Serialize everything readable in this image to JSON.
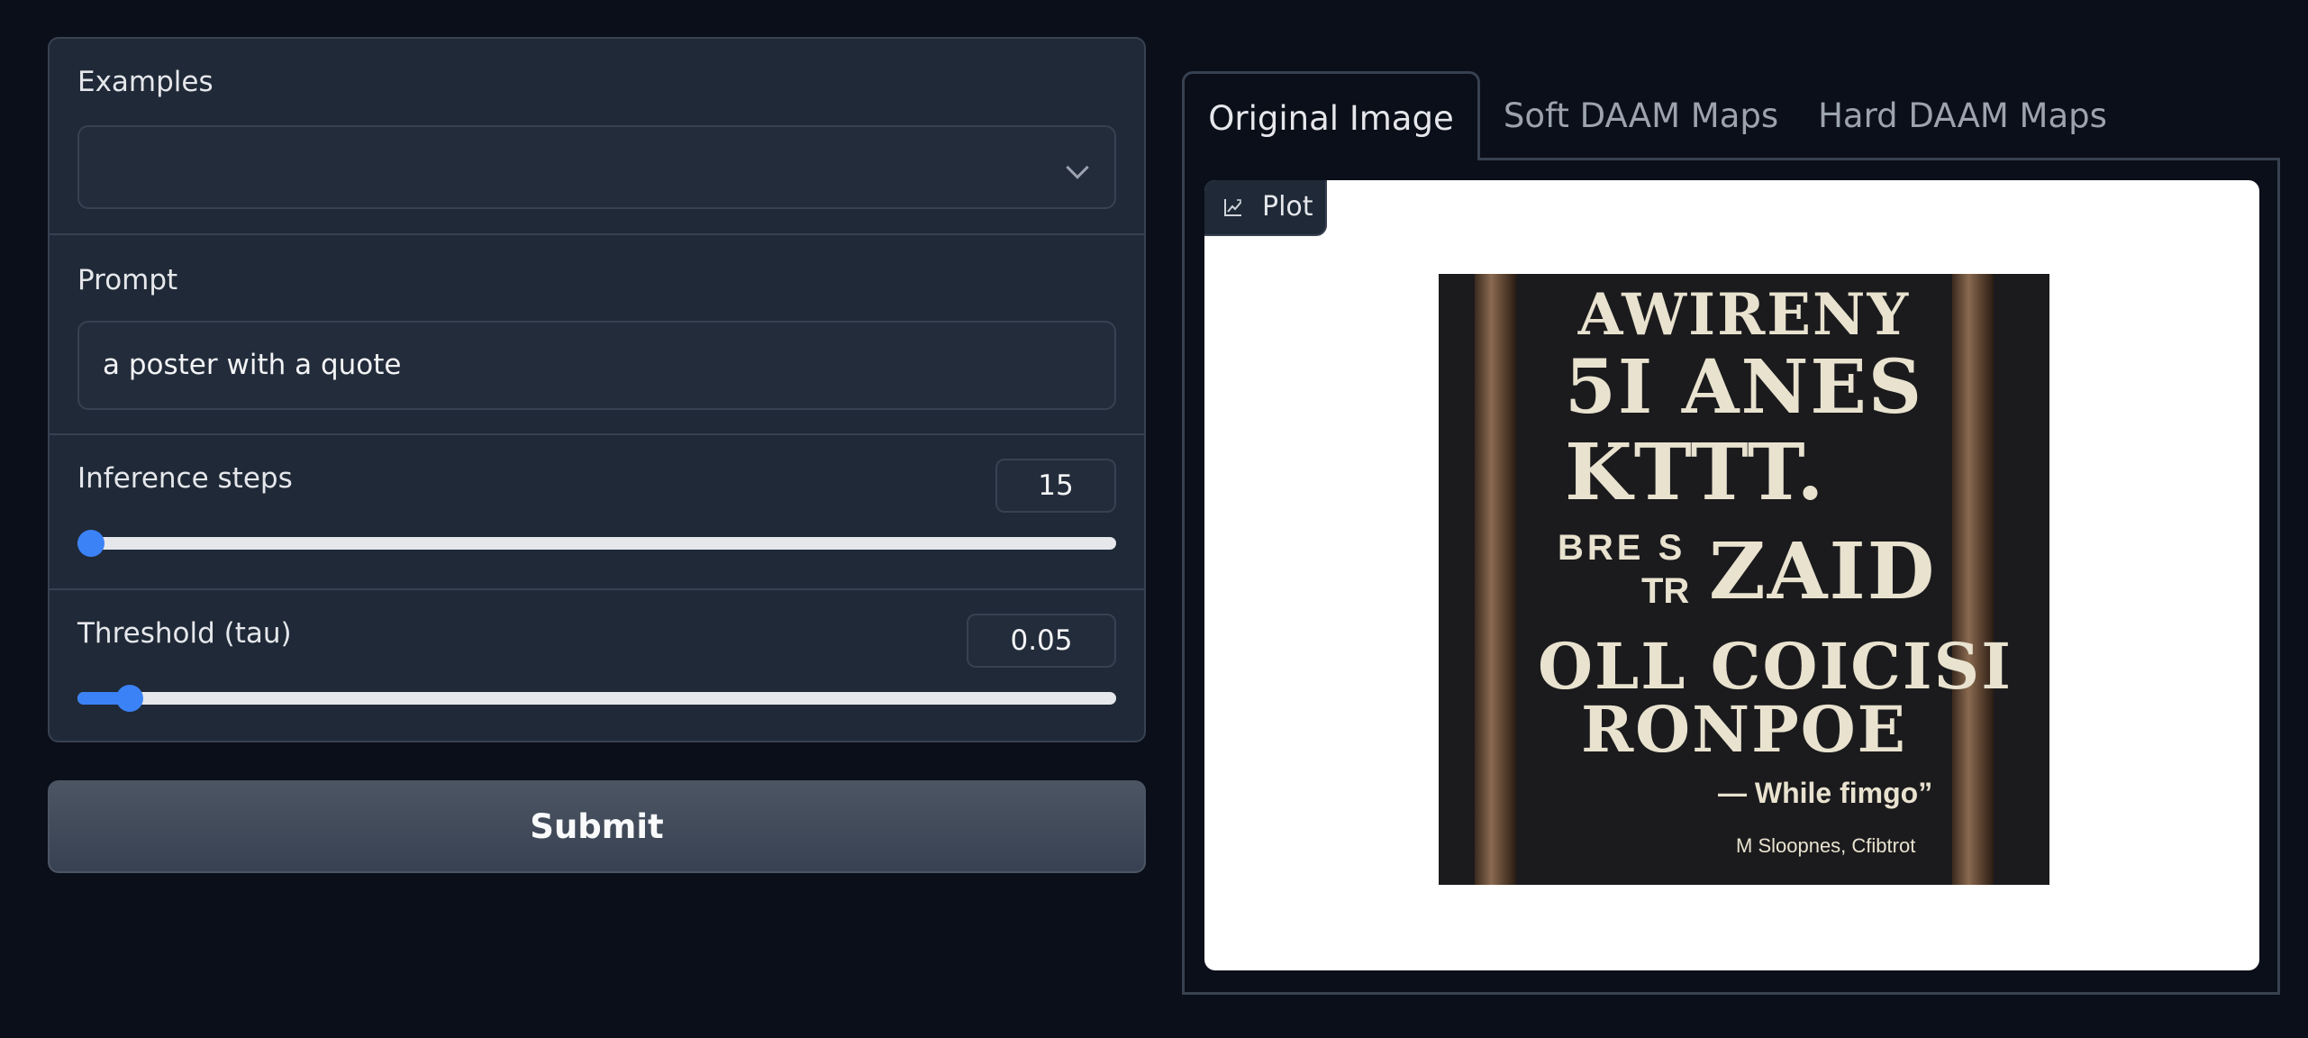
{
  "examples": {
    "label": "Examples",
    "value": ""
  },
  "prompt": {
    "label": "Prompt",
    "value": "a poster with a quote"
  },
  "inference_steps": {
    "label": "Inference steps",
    "value": "15",
    "fraction": 0.0
  },
  "threshold": {
    "label": "Threshold (tau)",
    "value": "0.05",
    "fraction": 0.05
  },
  "submit": {
    "label": "Submit"
  },
  "tabs": [
    {
      "label": "Original Image",
      "active": true
    },
    {
      "label": "Soft DAAM Maps",
      "active": false
    },
    {
      "label": "Hard DAAM Maps",
      "active": false
    }
  ],
  "plot": {
    "label": "Plot",
    "icon": "chart-icon"
  },
  "poster_text": {
    "line1": "AWIRENY",
    "line2": "5I ANES",
    "line3": "KTTT.",
    "line4a": "BRE S",
    "line4b": "TR",
    "line4c": "ZAID",
    "line5": "OLL COICISI",
    "line6": "RONPOE",
    "quote_author": "— While fimgo”",
    "footnote": "M Sloopnes, Cfibtrot"
  },
  "colors": {
    "accent": "#3b82f6",
    "background": "#0b0f19",
    "panel": "#1f2937",
    "border": "#374151"
  }
}
